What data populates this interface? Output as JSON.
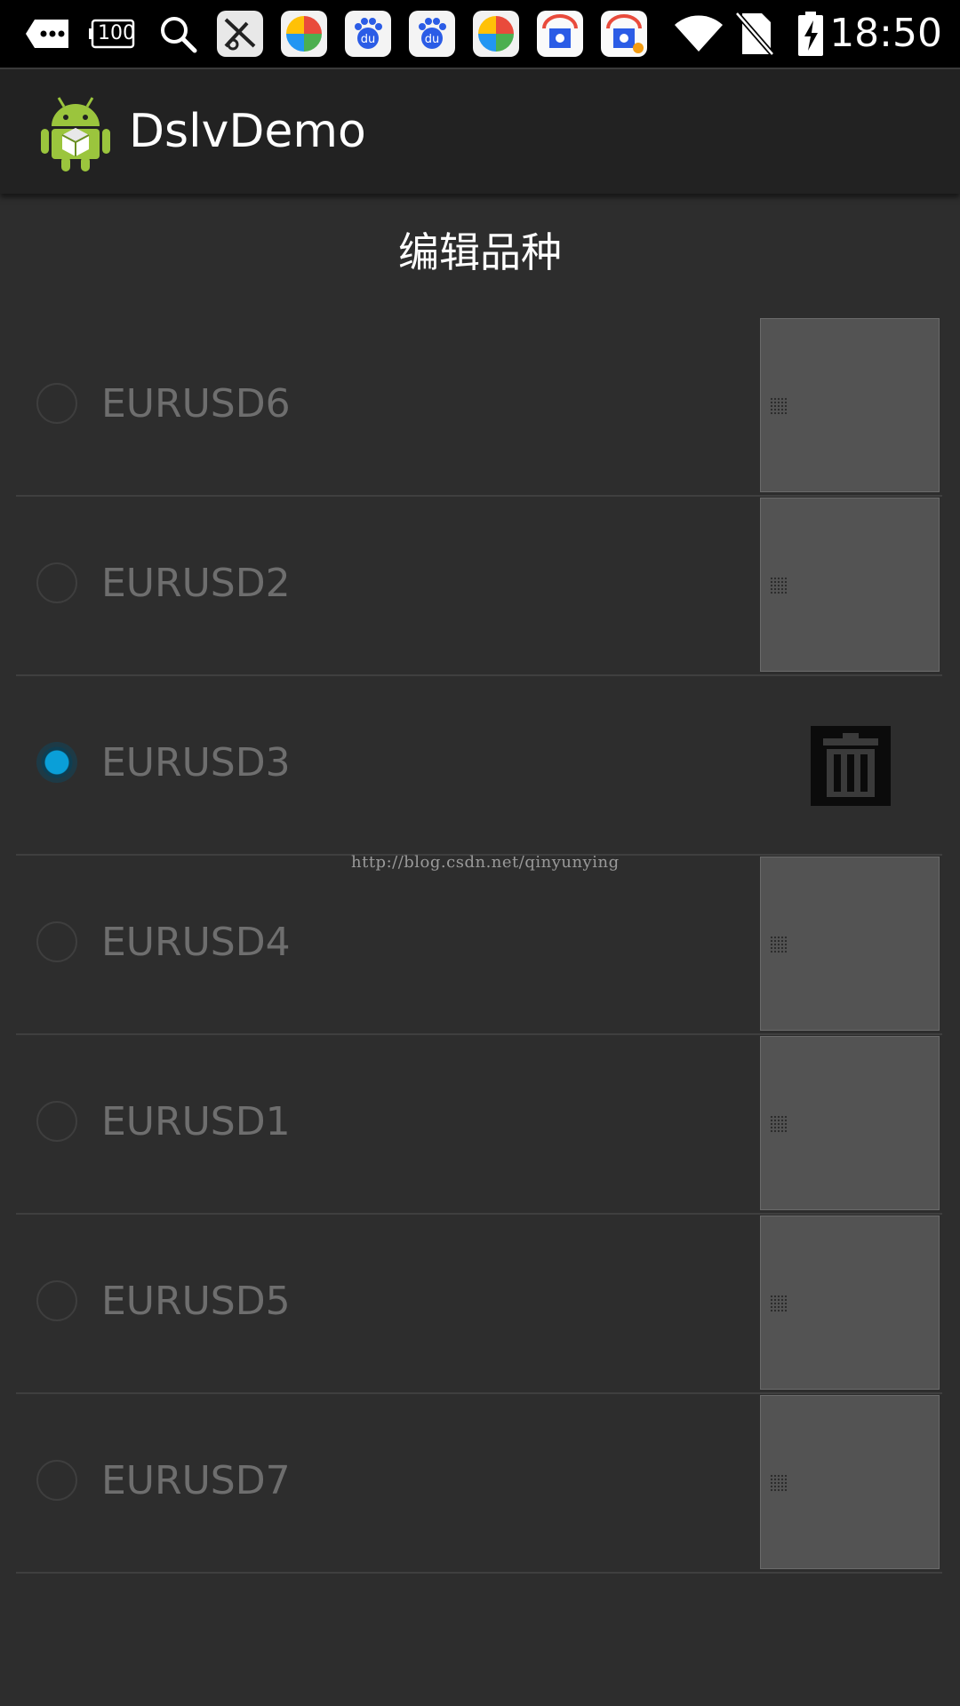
{
  "status_bar": {
    "battery_text": "100",
    "time": "18:50",
    "icons": [
      "more-icon",
      "battery-icon",
      "search-icon",
      "app-icon",
      "pinwheel-icon",
      "baidu-icon",
      "baidu-icon",
      "pinwheel-icon",
      "store-icon",
      "store-icon",
      "wifi-icon",
      "no-sim-icon",
      "charging-icon"
    ]
  },
  "app": {
    "title": "DslvDemo"
  },
  "page": {
    "title": "编辑品种"
  },
  "list": {
    "items": [
      {
        "label": "EURUSD6",
        "selected": false
      },
      {
        "label": "EURUSD2",
        "selected": false
      },
      {
        "label": "EURUSD3",
        "selected": true
      },
      {
        "label": "EURUSD4",
        "selected": false
      },
      {
        "label": "EURUSD1",
        "selected": false
      },
      {
        "label": "EURUSD5",
        "selected": false
      },
      {
        "label": "EURUSD7",
        "selected": false
      }
    ]
  },
  "watermark": "http://blog.csdn.net/qinyunying",
  "colors": {
    "accent": "#0a9fd8",
    "background": "#2d2d2d",
    "handle": "#535353"
  }
}
